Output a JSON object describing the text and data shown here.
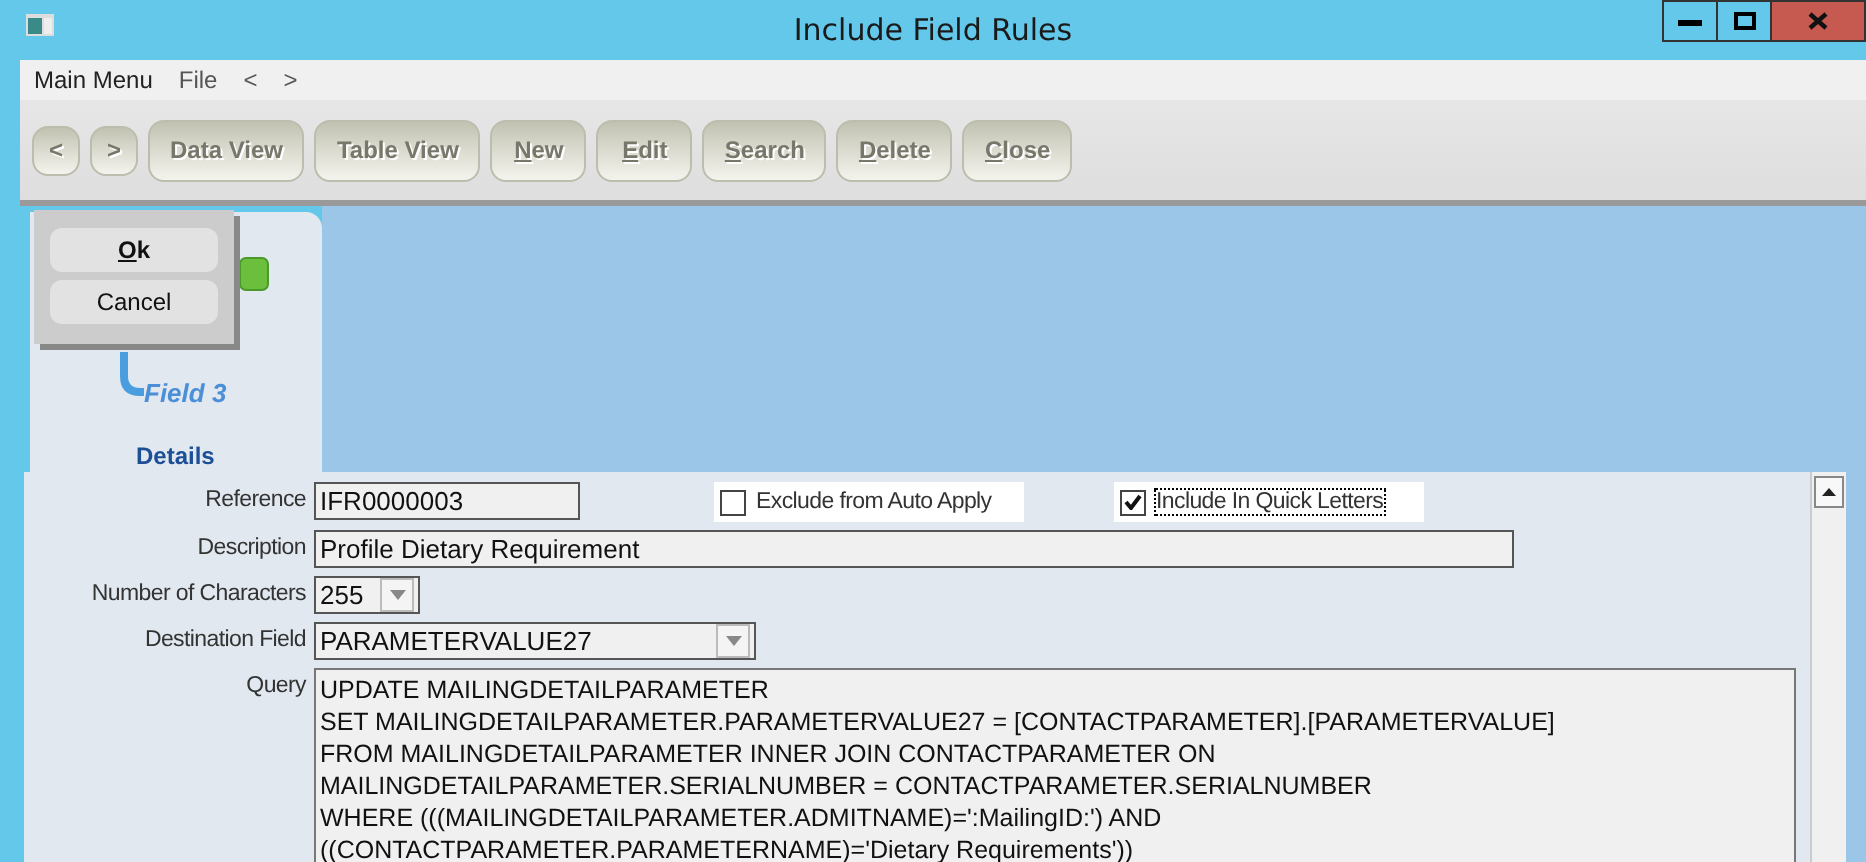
{
  "window": {
    "title": "Include Field Rules"
  },
  "menu": [
    "Main Menu",
    "File",
    "<",
    ">"
  ],
  "toolbar": [
    {
      "label": "<",
      "disabled": true,
      "kind": "arrow",
      "mnemonic": false
    },
    {
      "label": ">",
      "disabled": true,
      "kind": "arrow",
      "mnemonic": false
    },
    {
      "label": "Data View",
      "disabled": true,
      "kind": "text",
      "mnemonic": false
    },
    {
      "label": "Table View",
      "disabled": true,
      "kind": "text",
      "mnemonic": false
    },
    {
      "label": "New",
      "disabled": true,
      "kind": "text",
      "mnemonic": true
    },
    {
      "label": "Edit",
      "disabled": true,
      "kind": "text",
      "mnemonic": true
    },
    {
      "label": "Search",
      "disabled": true,
      "kind": "text",
      "mnemonic": true
    },
    {
      "label": "Delete",
      "disabled": true,
      "kind": "text",
      "mnemonic": true
    },
    {
      "label": "Close",
      "disabled": true,
      "kind": "text",
      "mnemonic": true
    }
  ],
  "diagram": {
    "fields": [
      "Field 3"
    ],
    "caption": "Details"
  },
  "popup": {
    "buttons": [
      {
        "label": "Ok",
        "mnemonic": true
      },
      {
        "label": "Cancel",
        "mnemonic": false
      }
    ]
  },
  "form": {
    "reference": {
      "label": "Reference",
      "value": "IFR0000003"
    },
    "checkboxes": [
      {
        "label": "Exclude from Auto Apply",
        "checked": false,
        "focused": false
      },
      {
        "label": "Include In Quick Letters",
        "checked": true,
        "focused": true
      }
    ],
    "description": {
      "label": "Description",
      "value": "Profile Dietary Requirement"
    },
    "characters": {
      "label": "Number of Characters",
      "value": "255"
    },
    "destination": {
      "label": "Destination Field",
      "value": "PARAMETERVALUE27"
    },
    "query": {
      "label": "Query",
      "lines": [
        "UPDATE MAILINGDETAILPARAMETER",
        "SET MAILINGDETAILPARAMETER.PARAMETERVALUE27 = [CONTACTPARAMETER].[PARAMETERVALUE]",
        "FROM MAILINGDETAILPARAMETER INNER JOIN CONTACTPARAMETER ON",
        "MAILINGDETAILPARAMETER.SERIALNUMBER = CONTACTPARAMETER.SERIALNUMBER",
        "WHERE (((MAILINGDETAILPARAMETER.ADMITNAME)=':MailingID:') AND",
        "((CONTACTPARAMETER.PARAMETERNAME)='Dietary Requirements'))"
      ]
    }
  }
}
